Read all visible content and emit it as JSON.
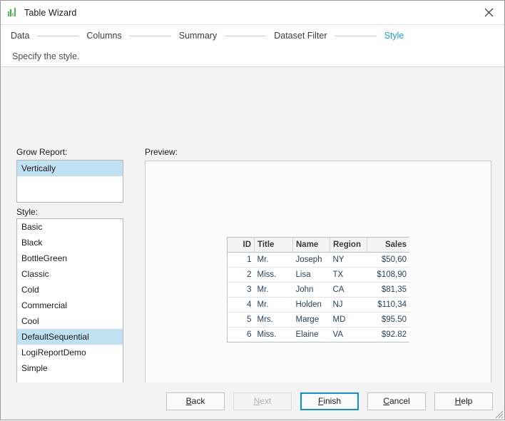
{
  "window": {
    "title": "Table Wizard",
    "icon": "bar-chart-icon",
    "close_icon": "close-icon",
    "accent_blue": "#1e9ae0",
    "selection_blue": "#bfe1f2"
  },
  "steps": [
    {
      "label": "Data",
      "active": false
    },
    {
      "label": "Columns",
      "active": false
    },
    {
      "label": "Summary",
      "active": false
    },
    {
      "label": "Dataset Filter",
      "active": false
    },
    {
      "label": "Style",
      "active": true
    }
  ],
  "description": "Specify the style.",
  "grow_report": {
    "label": "Grow Report:",
    "items": [
      {
        "label": "Vertically",
        "selected": true
      }
    ]
  },
  "style": {
    "label": "Style:",
    "items": [
      {
        "label": "Basic",
        "selected": false
      },
      {
        "label": "Black",
        "selected": false
      },
      {
        "label": "BottleGreen",
        "selected": false
      },
      {
        "label": "Classic",
        "selected": false
      },
      {
        "label": "Cold",
        "selected": false
      },
      {
        "label": "Commercial",
        "selected": false
      },
      {
        "label": "Cool",
        "selected": false
      },
      {
        "label": "DefaultSequential",
        "selected": true
      },
      {
        "label": "LogiReportDemo",
        "selected": false
      },
      {
        "label": "Simple",
        "selected": false
      }
    ]
  },
  "preview": {
    "label": "Preview:",
    "table": {
      "columns": [
        "ID",
        "Title",
        "Name",
        "Region",
        "Sales"
      ],
      "rows": [
        {
          "id": "1",
          "title": "Mr.",
          "name": "Joseph",
          "region": "NY",
          "sales": "$50,60"
        },
        {
          "id": "2",
          "title": "Miss.",
          "name": "Lisa",
          "region": "TX",
          "sales": "$108,90"
        },
        {
          "id": "3",
          "title": "Mr.",
          "name": "John",
          "region": "CA",
          "sales": "$81,35"
        },
        {
          "id": "4",
          "title": "Mr.",
          "name": "Holden",
          "region": "NJ",
          "sales": "$110,34"
        },
        {
          "id": "5",
          "title": "Mrs.",
          "name": "Marge",
          "region": "MD",
          "sales": "$95.50"
        },
        {
          "id": "6",
          "title": "Miss.",
          "name": "Elaine",
          "region": "VA",
          "sales": "$92.82"
        }
      ]
    }
  },
  "buttons": {
    "back": {
      "label": "Back",
      "mnemonic": "B",
      "rest": "ack",
      "disabled": false,
      "focused": false
    },
    "next": {
      "label": "Next",
      "mnemonic": "N",
      "rest": "ext",
      "disabled": true,
      "focused": false
    },
    "finish": {
      "label": "Finish",
      "mnemonic": "F",
      "rest": "inish",
      "disabled": false,
      "focused": true
    },
    "cancel": {
      "label": "Cancel",
      "mnemonic": "C",
      "rest": "ancel",
      "disabled": false,
      "focused": false
    },
    "help": {
      "label": "Help",
      "mnemonic": "H",
      "rest": "elp",
      "disabled": false,
      "focused": false
    }
  }
}
